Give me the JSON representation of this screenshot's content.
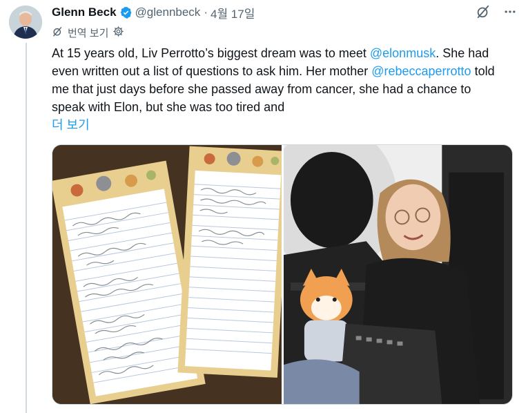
{
  "tweet": {
    "author_name": "Glenn Beck",
    "handle": "@glennbeck",
    "separator": "·",
    "date": "4월 17일",
    "translate_label": "번역 보기",
    "text": {
      "part1": "At 15 years old, Liv Perrotto’s biggest dream was to meet ",
      "mention1": "@elonmusk",
      "part2": ". She had even written out a list of questions to ask him. Her mother ",
      "mention2": "@rebeccaperrotto",
      "part3": " told me that just days before she passed away from cancer, she had a chance to speak with Elon, but she was too tired and",
      "show_more": "더 보기"
    }
  },
  "media": {
    "images": [
      {
        "name": "handwritten-question-lists"
      },
      {
        "name": "girl-in-spacecraft-seat-with-shiba-plush"
      }
    ]
  },
  "icons": {
    "verified": "verified-badge-icon",
    "grok": "grok-icon",
    "more": "more-icon",
    "translate": "translate-icon",
    "settings": "gear-icon"
  },
  "colors": {
    "accent": "#1d9bf0",
    "text": "#0f1419",
    "secondary": "#536471",
    "border": "#cfd9de"
  }
}
